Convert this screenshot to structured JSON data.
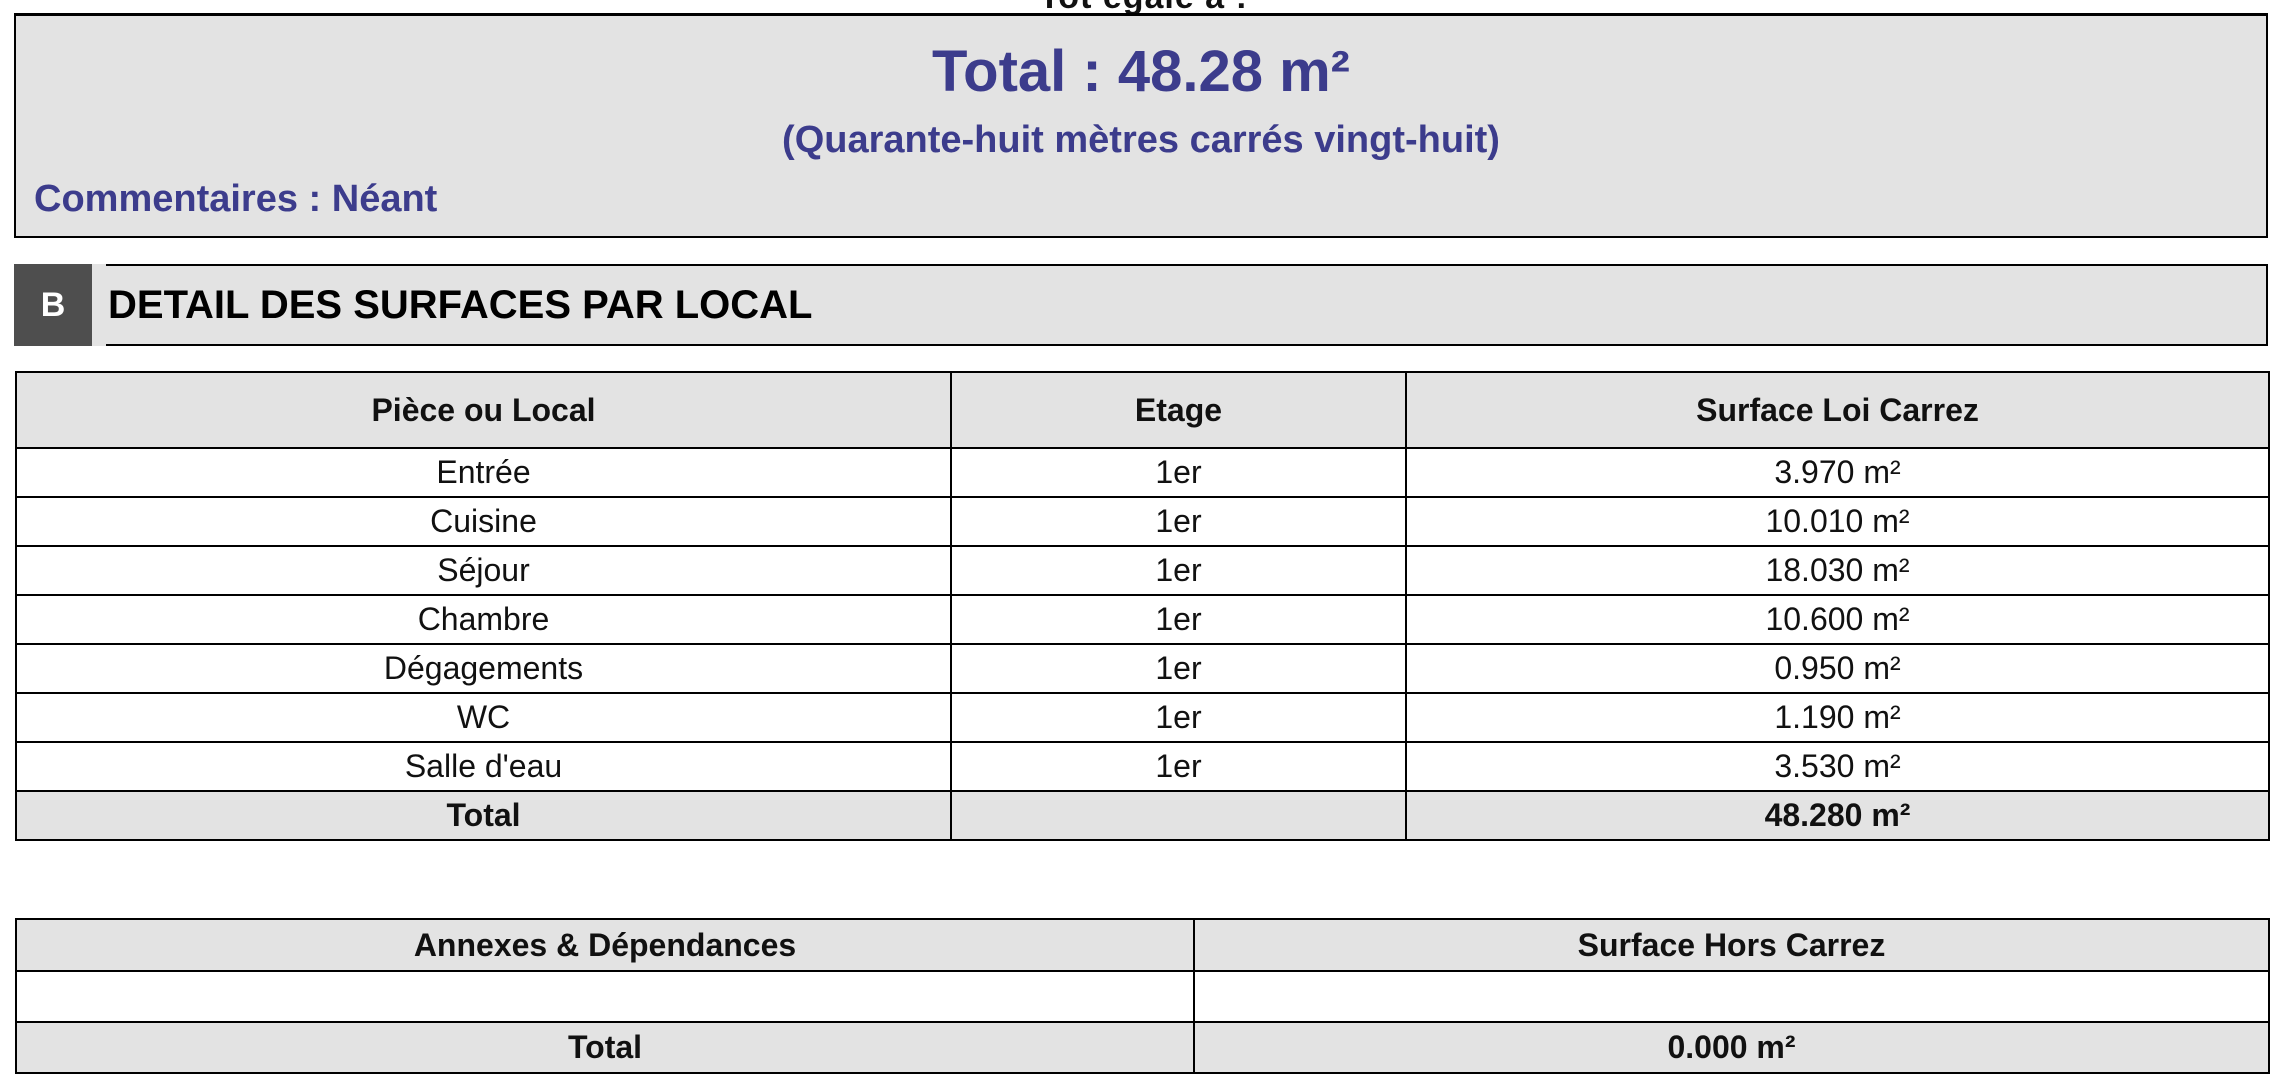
{
  "top_cut_text": "Tot égale à :",
  "summary": {
    "title": "Total : 48.28 m²",
    "subtitle": "(Quarante-huit mètres carrés vingt-huit)",
    "comment": "Commentaires : Néant"
  },
  "section": {
    "badge": "B",
    "title": "DETAIL DES SURFACES PAR LOCAL"
  },
  "rooms_table": {
    "headers": [
      "Pièce ou Local",
      "Etage",
      "Surface Loi Carrez"
    ],
    "rows": [
      [
        "Entrée",
        "1er",
        "3.970 m²"
      ],
      [
        "Cuisine",
        "1er",
        "10.010 m²"
      ],
      [
        "Séjour",
        "1er",
        "18.030 m²"
      ],
      [
        "Chambre",
        "1er",
        "10.600 m²"
      ],
      [
        "Dégagements",
        "1er",
        "0.950 m²"
      ],
      [
        "WC",
        "1er",
        "1.190 m²"
      ],
      [
        "Salle d'eau",
        "1er",
        "3.530 m²"
      ]
    ],
    "total": [
      "Total",
      "",
      "48.280 m²"
    ]
  },
  "annex_table": {
    "headers": [
      "Annexes & Dépendances",
      "Surface Hors Carrez"
    ],
    "rows": [
      [
        "",
        ""
      ]
    ],
    "total": [
      "Total",
      "0.000 m²"
    ]
  }
}
